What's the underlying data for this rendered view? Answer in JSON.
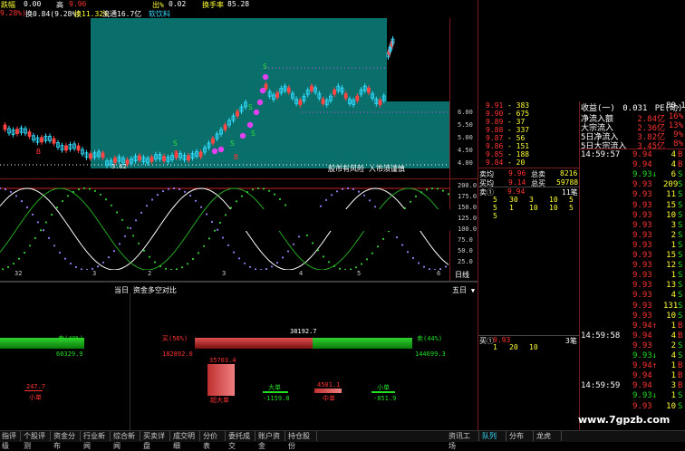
{
  "header": {
    "t1": "跌幅",
    "t1v": "0.00",
    "t2": "高",
    "t2v": "9.96",
    "t3": "出%",
    "t3v": "0.02",
    "t4": "换手率",
    "t4v": "85.28",
    "line2a": "9.28%)",
    "line2b": "换0.84(9.28%)",
    "line2c": "换11.32%",
    "line2d": "流通16.7亿",
    "line2e": "软饮料"
  },
  "kline": {
    "watermark": "股市有风险 入市须谨慎",
    "price_ticks": [
      "6.00",
      "5.50",
      "5.00",
      "4.50",
      "4.00"
    ],
    "low_label": "3.62",
    "markers": [
      "B",
      "B",
      "S",
      "S",
      "S",
      "B",
      "B",
      "S",
      "B"
    ]
  },
  "oscillator": {
    "ticks": [
      "200.0",
      "175.0",
      "150.0",
      "125.0",
      "100.0",
      "75.0",
      "50.0",
      "25.0"
    ],
    "x_labels": [
      "32",
      "3",
      "2",
      "3",
      "4",
      "5",
      "6"
    ],
    "period_label": "日线"
  },
  "capital": {
    "title": "当日 资金多空对比",
    "period": "五日",
    "left_label": "卖(40%)",
    "left_value": "60329.9",
    "buy_label": "买(56%)",
    "buy_value": "182892.0",
    "mid_value": "38192.7",
    "sell_label": "卖(44%)",
    "sell_value": "144699.3",
    "bars": [
      {
        "name": "小单",
        "value": "247.7"
      },
      {
        "name": "超大单",
        "value": "35703.4"
      },
      {
        "name": "大单",
        "value": "-1159.8"
      },
      {
        "name": "中单",
        "value": "4501.1"
      },
      {
        "name": "中单2",
        "value": "-851.9"
      },
      {
        "name": "小单2",
        "value": "小单"
      }
    ],
    "labels": {
      "small_left": "小单",
      "superlarge": "超大单",
      "large": "大单",
      "medium": "中单",
      "small": "小单"
    }
  },
  "orderbook": {
    "sells": [
      {
        "p": "9.91",
        "v": "383"
      },
      {
        "p": "9.90",
        "v": "675"
      },
      {
        "p": "9.89",
        "v": "37"
      },
      {
        "p": "9.88",
        "v": "337"
      },
      {
        "p": "9.87",
        "v": "56"
      },
      {
        "p": "9.86",
        "v": "151"
      },
      {
        "p": "9.85",
        "v": "188"
      },
      {
        "p": "9.84",
        "v": "20"
      }
    ],
    "avg_sell_label": "卖均",
    "avg_sell": "9.96",
    "total_sell_label": "总卖",
    "total_sell": "8216",
    "avg_buy_label": "买均",
    "avg_buy": "9.14",
    "total_buy_label": "总买",
    "total_buy": "59788",
    "sell1_label": "卖①",
    "sell1_price": "9.94",
    "sell1_count": "11笔",
    "queue1": [
      "5",
      "30",
      "3",
      "10",
      "5"
    ],
    "queue2": [
      "5",
      "1",
      "10",
      "10",
      "5"
    ],
    "queue3": [
      "5"
    ],
    "buy1_label": "买①",
    "buy1_price": "9.93",
    "buy1_count": "3笔",
    "buy_queue": [
      "1",
      "20",
      "10"
    ]
  },
  "stats": {
    "r1l": "收益(一)",
    "r1v": "0.031",
    "r1l2": "PE(动)",
    "r1v2": "80.1",
    "r2l": "净流入额",
    "r2v": "2.84亿",
    "r2p": "16%",
    "r3l": "大宗流入",
    "r3v": "2.36亿",
    "r3p": "13%",
    "r4l": "5日净流入",
    "r4v": "3.82亿",
    "r4p": "9%",
    "r5l": "5日大宗流入",
    "r5v": "3.45亿",
    "r5p": "8%"
  },
  "ticks": [
    {
      "t": "14:59:57",
      "p": "9.94",
      "v": "4",
      "d": "B"
    },
    {
      "t": "",
      "p": "9.94",
      "v": "4",
      "d": "B"
    },
    {
      "t": "",
      "p": "9.93↓",
      "v": "6",
      "d": "S"
    },
    {
      "t": "",
      "p": "9.93",
      "v": "209",
      "d": "S"
    },
    {
      "t": "",
      "p": "9.93",
      "v": "11",
      "d": "S"
    },
    {
      "t": "",
      "p": "9.93",
      "v": "15",
      "d": "S"
    },
    {
      "t": "",
      "p": "9.93",
      "v": "10",
      "d": "S"
    },
    {
      "t": "",
      "p": "9.93",
      "v": "3",
      "d": "S"
    },
    {
      "t": "",
      "p": "9.93",
      "v": "2",
      "d": "S"
    },
    {
      "t": "",
      "p": "9.93",
      "v": "1",
      "d": "S"
    },
    {
      "t": "",
      "p": "9.93",
      "v": "15",
      "d": "S"
    },
    {
      "t": "",
      "p": "9.93",
      "v": "12",
      "d": "S"
    },
    {
      "t": "",
      "p": "9.93",
      "v": "1",
      "d": "S"
    },
    {
      "t": "",
      "p": "9.93",
      "v": "13",
      "d": "S"
    },
    {
      "t": "",
      "p": "9.93",
      "v": "4",
      "d": "S"
    },
    {
      "t": "",
      "p": "9.93",
      "v": "131",
      "d": "S"
    },
    {
      "t": "",
      "p": "9.93",
      "v": "10",
      "d": "S"
    },
    {
      "t": "",
      "p": "9.94↑",
      "v": "1",
      "d": "B"
    },
    {
      "t": "14:59:58",
      "p": "9.94",
      "v": "4",
      "d": "B"
    },
    {
      "t": "",
      "p": "9.93",
      "v": "2",
      "d": "S"
    },
    {
      "t": "",
      "p": "9.93↓",
      "v": "4",
      "d": "S"
    },
    {
      "t": "",
      "p": "9.94↑",
      "v": "1",
      "d": "B"
    },
    {
      "t": "",
      "p": "9.94",
      "v": "1",
      "d": "B"
    },
    {
      "t": "14:59:59",
      "p": "9.94",
      "v": "3",
      "d": "B"
    },
    {
      "t": "",
      "p": "9.93↓",
      "v": "1",
      "d": "S"
    },
    {
      "t": "",
      "p": "9.93",
      "v": "10",
      "d": "S"
    }
  ],
  "tabs": [
    "指评级",
    "个股评测",
    "资金分布",
    "行业新闻",
    "综合新闻",
    "买卖详盘",
    "成交明细",
    "分价表",
    "委托成交",
    "账户资金",
    "持仓股份",
    "资讯工场",
    "队列",
    "分布",
    "龙虎"
  ],
  "watermark_site": "www.7gpzb.com"
}
